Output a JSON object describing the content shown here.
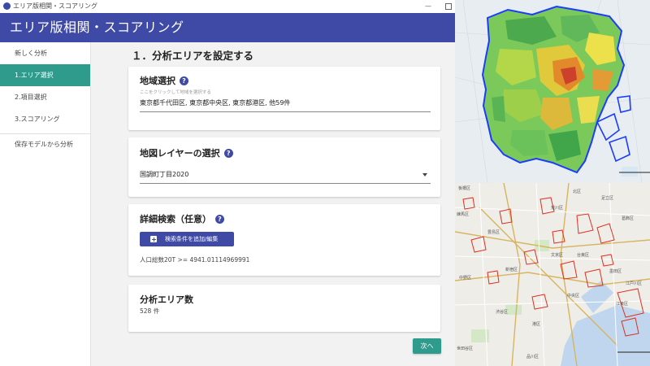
{
  "window": {
    "title": "エリア版相関・スコアリング",
    "minimize_glyph": "—"
  },
  "header": {
    "title": "エリア版相関・スコアリング"
  },
  "sidebar": {
    "items": [
      {
        "label": "新しく分析",
        "active": false
      },
      {
        "label": "1.エリア選択",
        "active": true
      },
      {
        "label": "2.項目選択",
        "active": false
      },
      {
        "label": "3.スコアリング",
        "active": false
      },
      {
        "label": "保存モデルから分析",
        "active": false
      }
    ]
  },
  "main": {
    "title": "１．分析エリアを設定する",
    "region": {
      "title": "地域選択",
      "hint": "ここをクリックして地域を選択する",
      "value": "東京都千代田区, 東京都中央区, 東京都港区, 他59件"
    },
    "layer": {
      "title": "地図レイヤーの選択",
      "value": "国調町丁目2020"
    },
    "detail": {
      "title": "詳細検索（任意）",
      "button_label": "検索条件を追加/編集",
      "condition": "人口総数20T >= 4941.01114969991"
    },
    "count": {
      "title": "分析エリア数",
      "value": "528 件"
    },
    "next_label": "次へ",
    "help_glyph": "?"
  },
  "map_labels": {
    "l1": "板橋区",
    "l2": "北区",
    "l3": "荒川区",
    "l4": "文京区",
    "l5": "中野区",
    "l6": "新宿区",
    "l7": "台東区",
    "l8": "墨田区",
    "l9": "渋谷区",
    "l10": "中央区",
    "l11": "江東区",
    "l12": "港区",
    "l13": "品川区",
    "l14": "江戸川区",
    "l15": "豊島区",
    "l16": "練馬区",
    "l17": "世田谷区",
    "l18": "葛飾区",
    "l19": "足立区"
  },
  "colors": {
    "header": "#3f4aa7",
    "active_nav": "#2e9b8c",
    "next_button": "#2e9b8c",
    "map_outline": "#1a3cff",
    "polygon_red": "#e0301e"
  }
}
